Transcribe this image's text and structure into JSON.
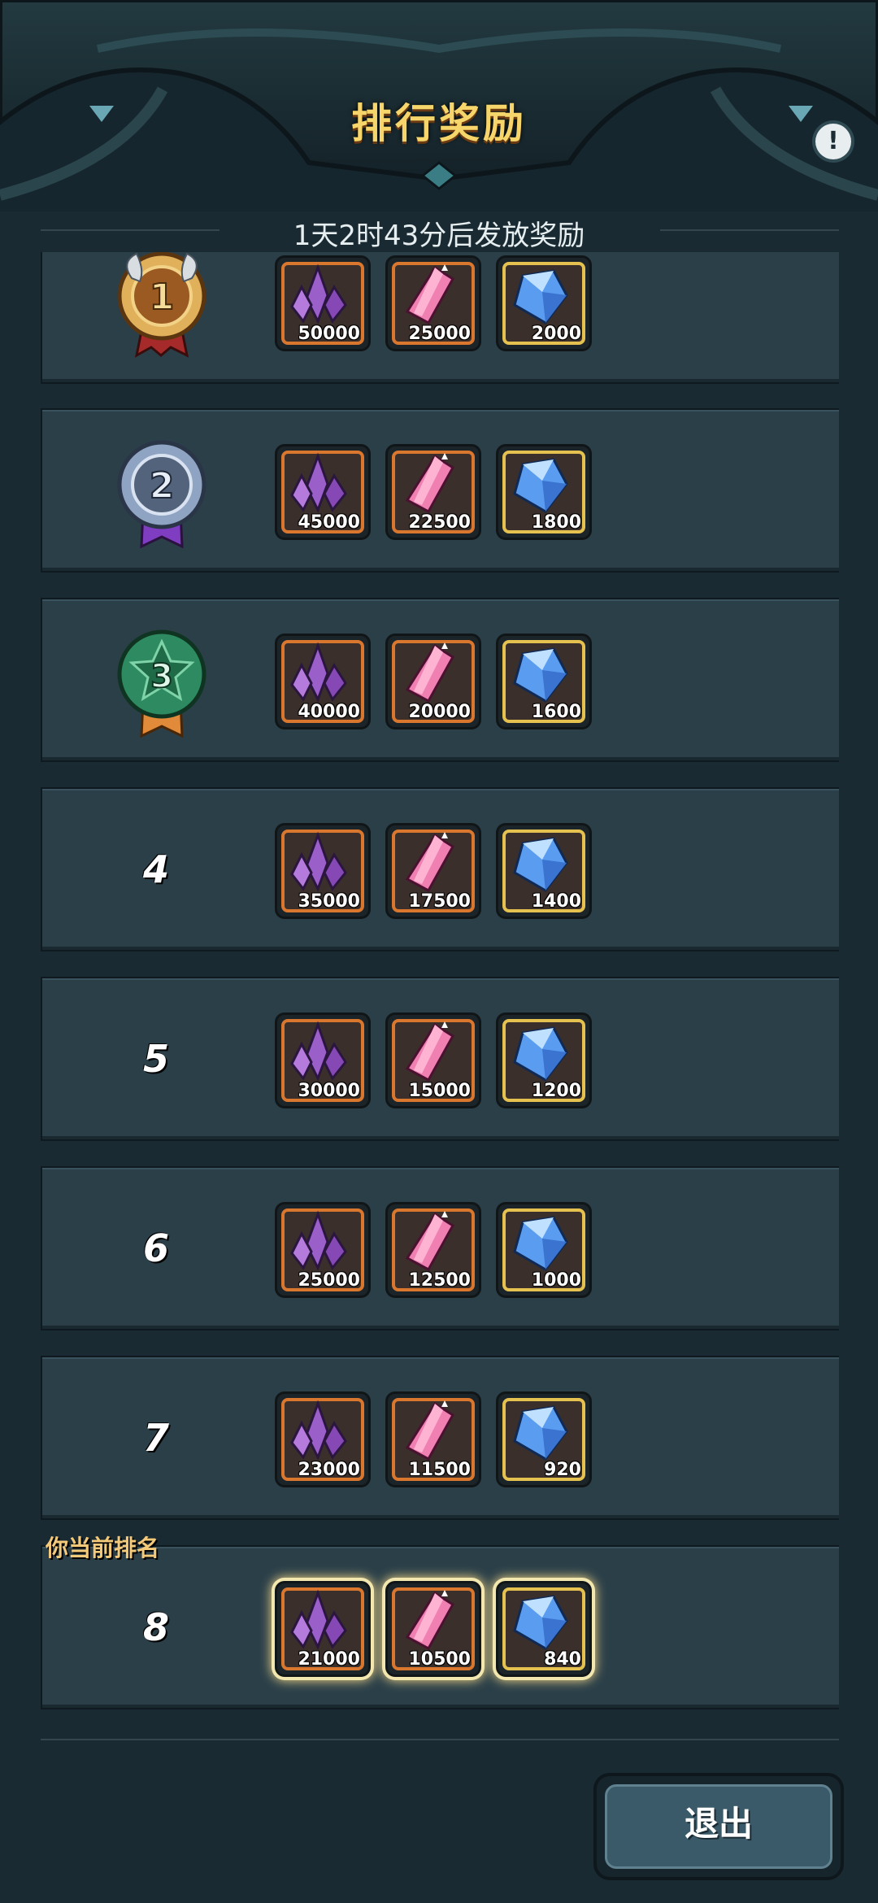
{
  "header": {
    "title": "排行奖励",
    "info_icon": "exclamation-icon",
    "countdown": "1天2时43分后发放奖励"
  },
  "rewards": [
    {
      "rank": "1",
      "medal": "gold-medal-icon",
      "items": [
        "50000",
        "25000",
        "2000"
      ]
    },
    {
      "rank": "2",
      "medal": "silver-medal-icon",
      "items": [
        "45000",
        "22500",
        "1800"
      ]
    },
    {
      "rank": "3",
      "medal": "bronze-medal-icon",
      "items": [
        "40000",
        "20000",
        "1600"
      ]
    },
    {
      "rank": "4",
      "items": [
        "35000",
        "17500",
        "1400"
      ]
    },
    {
      "rank": "5",
      "items": [
        "30000",
        "15000",
        "1200"
      ]
    },
    {
      "rank": "6",
      "items": [
        "25000",
        "12500",
        "1000"
      ]
    },
    {
      "rank": "7",
      "items": [
        "23000",
        "11500",
        "920"
      ]
    },
    {
      "rank": "8",
      "items": [
        "21000",
        "10500",
        "840"
      ]
    }
  ],
  "current_rank_label": "你当前排名",
  "current_rank": "8",
  "item_icons": [
    "purple-crystal-icon",
    "pink-gem-icon",
    "blue-diamond-icon"
  ],
  "footer": {
    "exit_label": "退出"
  },
  "colors": {
    "title": "#f6d66a",
    "panel": "#2b3f49",
    "orange_frame": "#d9772f",
    "gold_frame": "#e5c14f"
  }
}
